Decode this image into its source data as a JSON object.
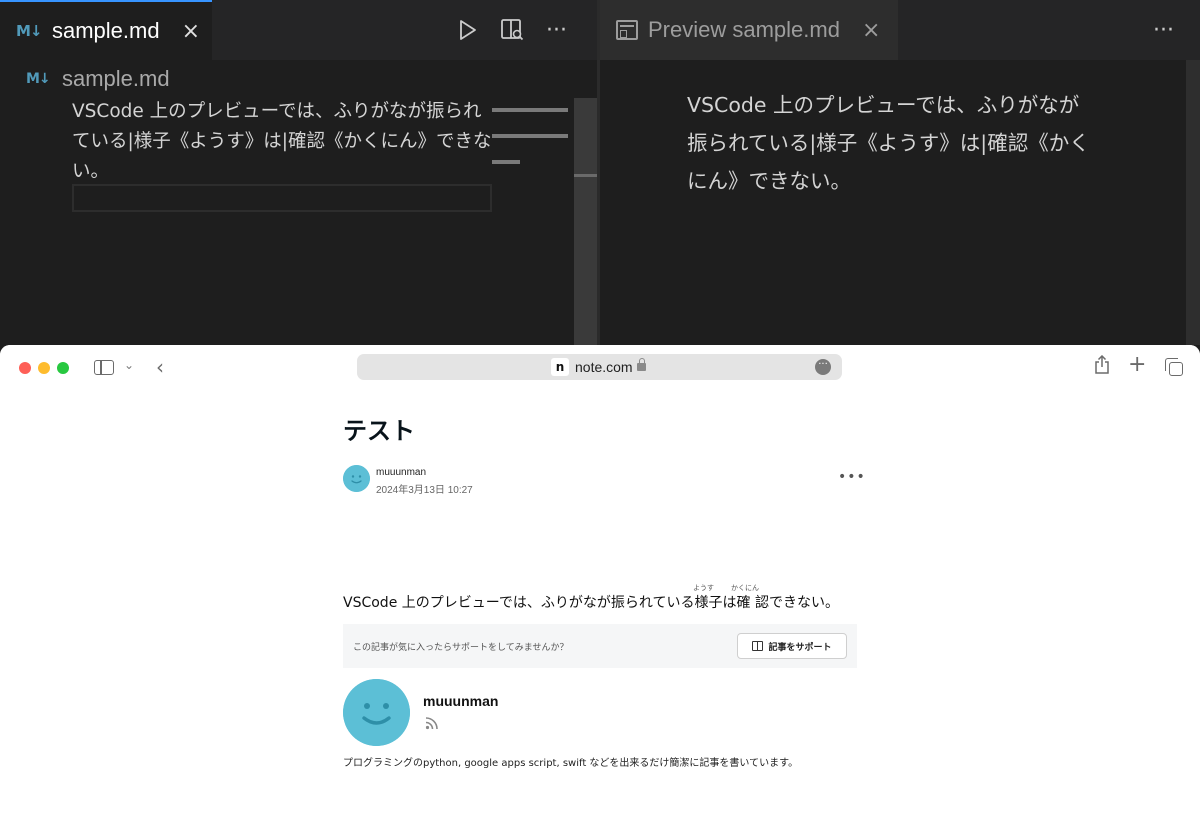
{
  "vscode": {
    "editor_tab": {
      "icon": "markdown-icon",
      "label": "sample.md",
      "close": "×"
    },
    "preview_tab": {
      "icon": "preview-icon",
      "label": "Preview sample.md",
      "close": "×"
    },
    "editor_actions": [
      "run-icon",
      "open-preview-icon",
      "more-icon"
    ],
    "more_label": "···",
    "breadcrumb": {
      "icon": "markdown-icon",
      "label": "sample.md"
    },
    "editor_text": "VSCode 上のプレビューでは、ふりがなが振られている|様子《ようす》は|確認《かくにん》できない。",
    "preview_text": "VSCode 上のプレビューでは、ふりがなが振られている|様子《ようす》は|確認《かくにん》できない。",
    "md_icon_text": "M↓"
  },
  "safari": {
    "address": {
      "favicon": "n",
      "url": "note.com"
    },
    "icons": [
      "sidebar-icon",
      "chevron-down-icon",
      "back-icon",
      "lock-icon",
      "page-menu-icon",
      "share-icon",
      "plus-icon",
      "tabs-icon"
    ],
    "chevron": "⌄",
    "back": "‹",
    "new_tab": "+"
  },
  "article": {
    "title": "テスト",
    "author": "muuunman",
    "date": "2024年3月13日 10:27",
    "more": "•••",
    "body": "VSCode 上のプレビューでは、ふりがなが振られている様子は確 認できない。",
    "ruby_1": "ようす",
    "ruby_2": "かくにん",
    "support_prompt": "この記事が気に入ったらサポートをしてみませんか？",
    "support_button": "記事をサポート",
    "profile_name": "muuunman",
    "profile_bio": "プログラミングのpython, google apps script, swift などを出来るだけ簡潔に記事を書いています。"
  },
  "colors": {
    "accent": "#3794ff",
    "markdown_icon": "#519aba",
    "avatar": "#5cbfd6"
  }
}
